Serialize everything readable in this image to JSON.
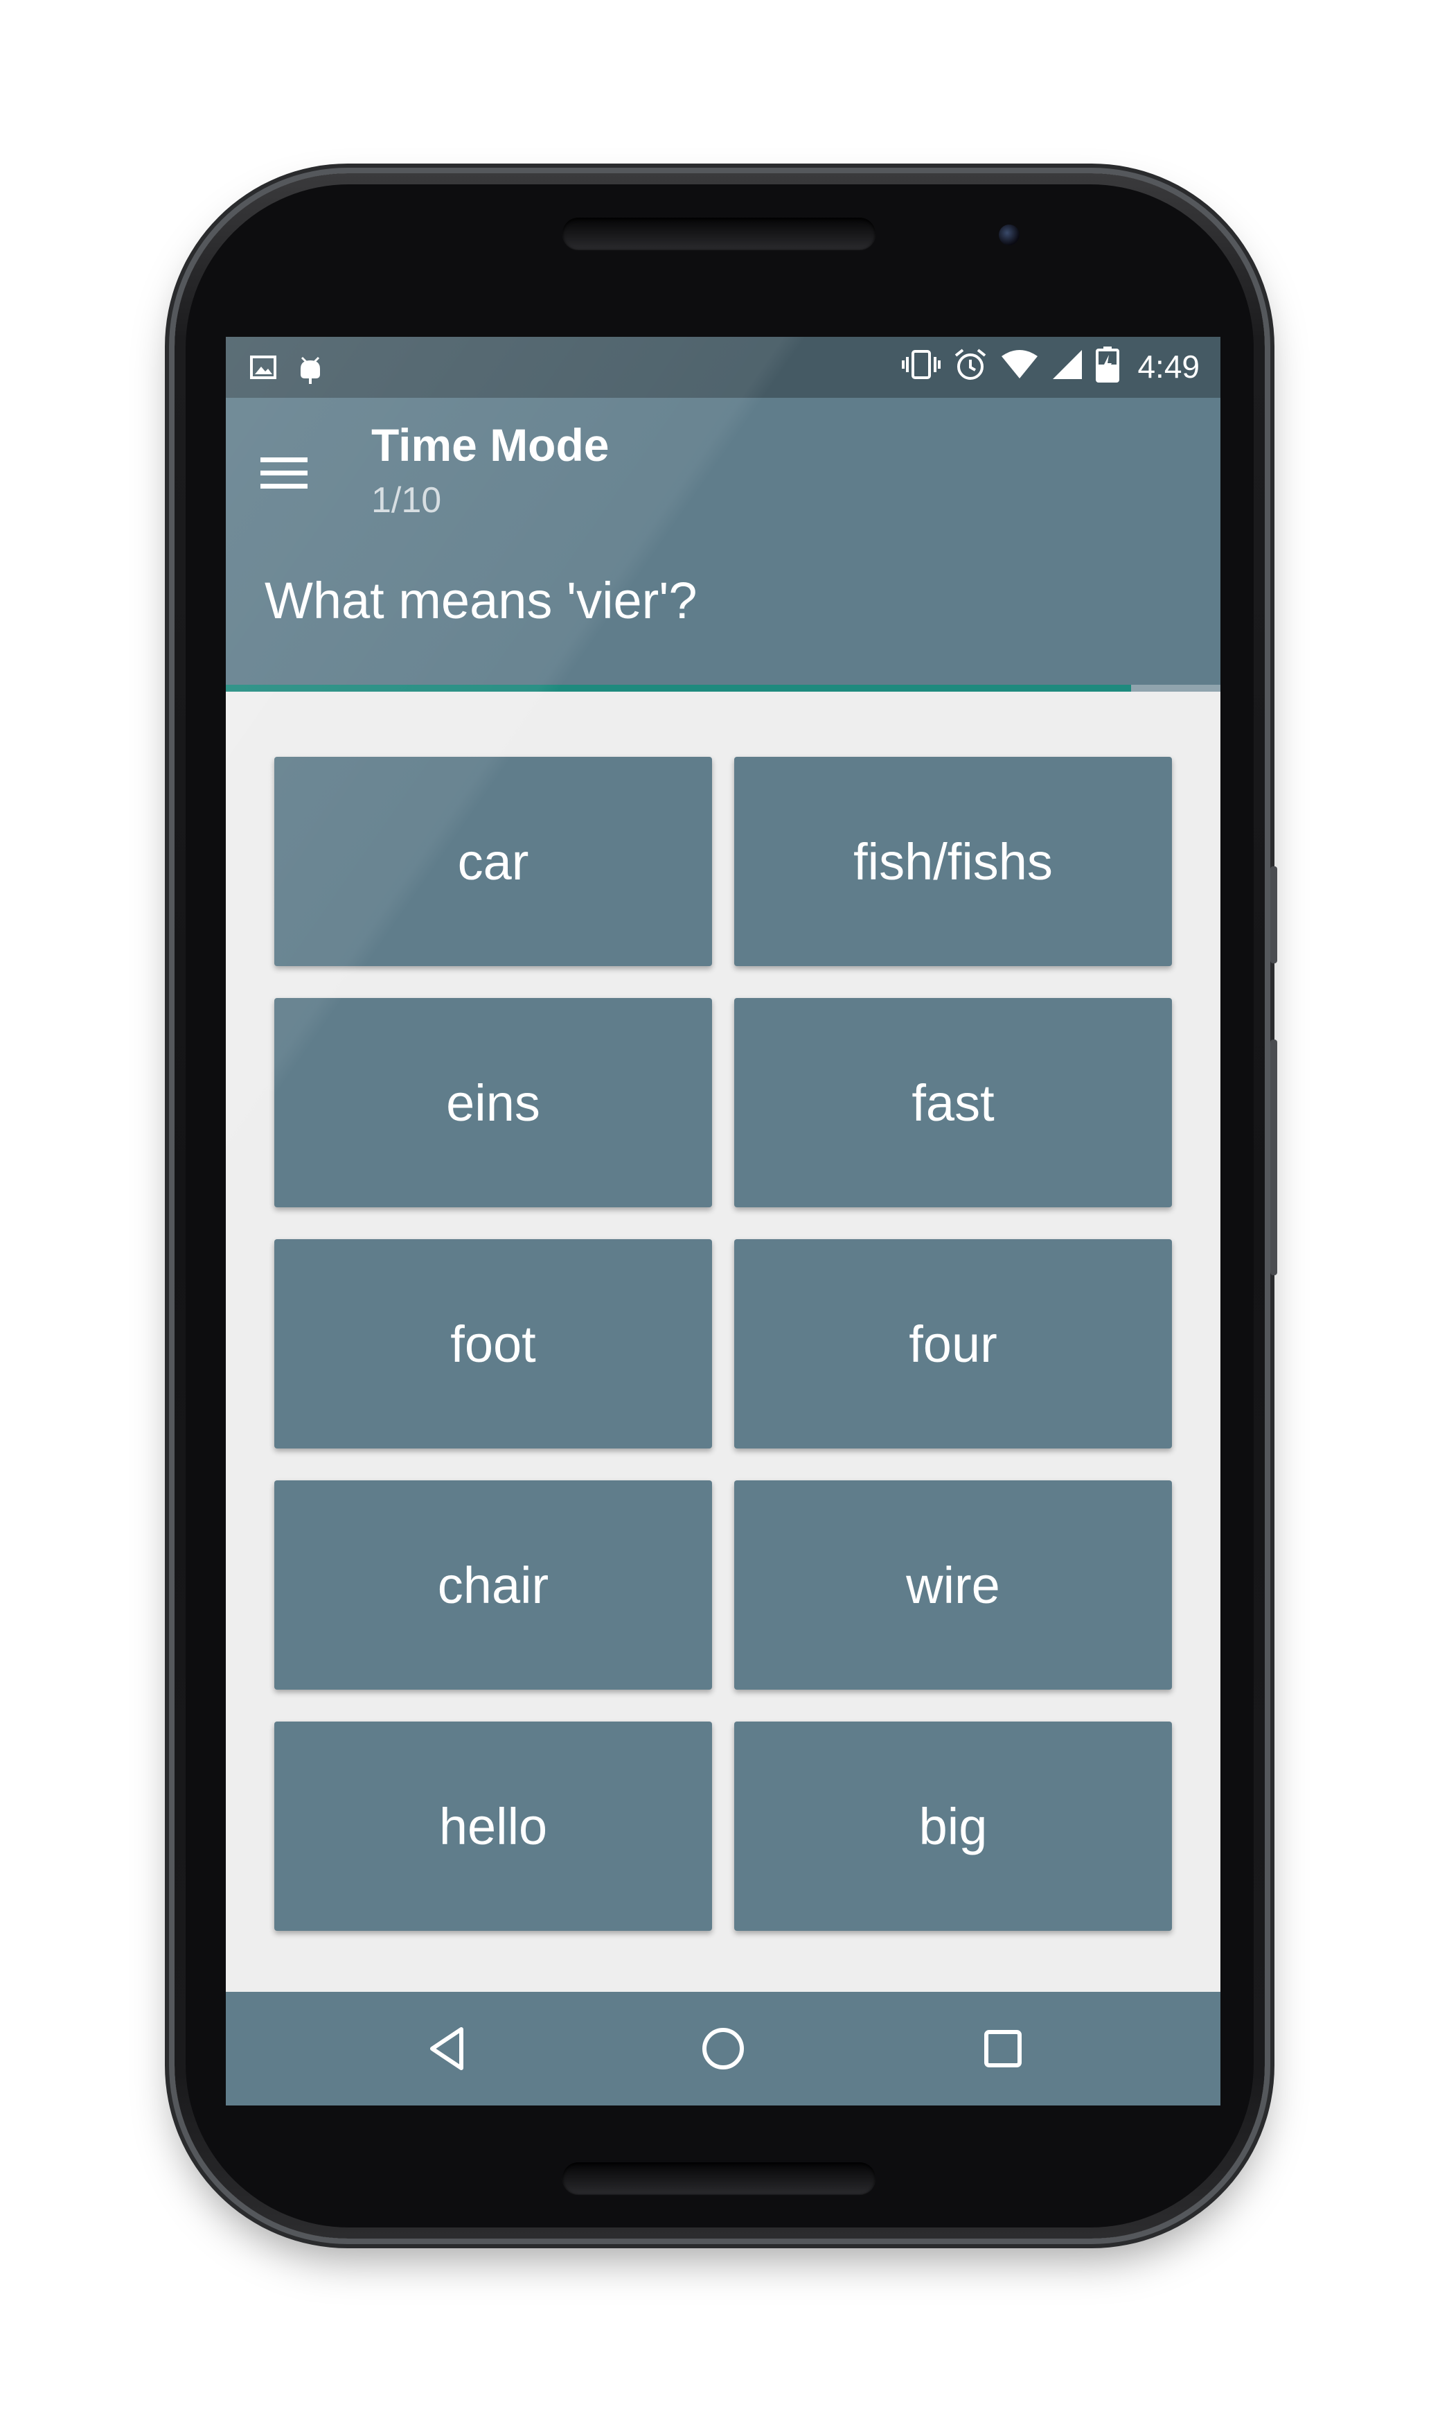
{
  "status_bar": {
    "time": "4:49",
    "left_icons": [
      "image-icon",
      "android-debug-icon"
    ],
    "right_icons": [
      "vibrate-icon",
      "alarm-icon",
      "wifi-icon",
      "signal-icon",
      "battery-charging-icon"
    ]
  },
  "toolbar": {
    "title": "Time Mode",
    "subtitle": "1/10",
    "menu_icon": "hamburger-menu-icon"
  },
  "question": {
    "text": "What means 'vier'?"
  },
  "progress": {
    "value": 0.91
  },
  "answers": [
    {
      "label": "car"
    },
    {
      "label": "fish/fishs"
    },
    {
      "label": "eins"
    },
    {
      "label": "fast"
    },
    {
      "label": "foot"
    },
    {
      "label": "four"
    },
    {
      "label": "chair"
    },
    {
      "label": "wire"
    },
    {
      "label": "hello"
    },
    {
      "label": "big"
    }
  ],
  "nav_bar": {
    "icons": [
      "back-icon",
      "home-icon",
      "recents-icon"
    ]
  },
  "colors": {
    "status_bar": "#455a64",
    "primary": "#607d8b",
    "background": "#eeeeee",
    "accent": "#1e8a7e",
    "text": "#ffffff"
  }
}
